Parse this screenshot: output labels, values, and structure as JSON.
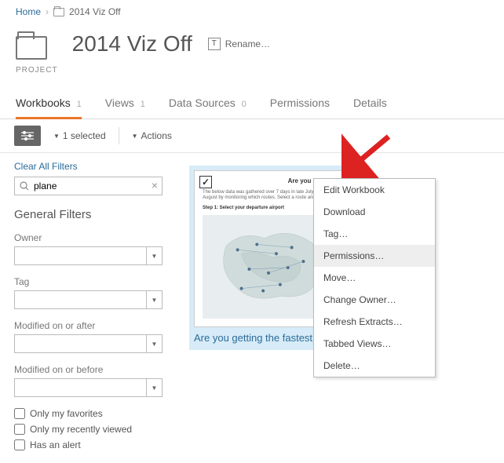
{
  "breadcrumb": {
    "home": "Home",
    "current": "2014 Viz Off"
  },
  "header": {
    "title": "2014 Viz Off",
    "project_label": "PROJECT",
    "rename": "Rename…"
  },
  "tabs": {
    "workbooks": {
      "label": "Workbooks",
      "count": "1"
    },
    "views": {
      "label": "Views",
      "count": "1"
    },
    "datasources": {
      "label": "Data Sources",
      "count": "0"
    },
    "permissions": {
      "label": "Permissions"
    },
    "details": {
      "label": "Details"
    }
  },
  "toolbar": {
    "selected": "1 selected",
    "actions": "Actions"
  },
  "sidebar": {
    "clear": "Clear All Filters",
    "search_value": "plane",
    "section": "General Filters",
    "owner": "Owner",
    "tag": "Tag",
    "mod_after": "Modified on or after",
    "mod_before": "Modified on or before",
    "favorites": "Only my favorites",
    "recent": "Only my recently viewed",
    "alert": "Has an alert"
  },
  "card": {
    "thumb_title": "Are you ge…",
    "thumb_sub": "The below data was gathered over 7 days in late July - early August by monitoring which routes. Select a route and compare.",
    "thumb_step": "Step 1: Select your departure airport",
    "label": "Are you getting the fastest plane?"
  },
  "menu": {
    "edit": "Edit Workbook",
    "download": "Download",
    "tag": "Tag…",
    "permissions": "Permissions…",
    "move": "Move…",
    "change_owner": "Change Owner…",
    "refresh": "Refresh Extracts…",
    "tabbed": "Tabbed Views…",
    "delete": "Delete…"
  }
}
